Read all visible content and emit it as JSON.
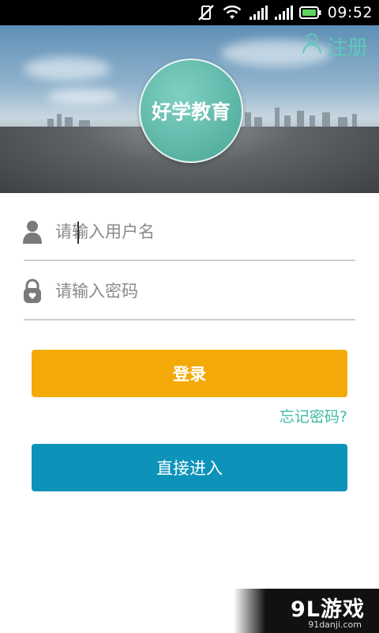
{
  "status_bar": {
    "time": "09:52"
  },
  "header": {
    "register_label": "注册",
    "logo_text": "好学教育"
  },
  "form": {
    "username_placeholder": "请输入用户名",
    "username_value": "",
    "password_placeholder": "请输入密码",
    "password_value": ""
  },
  "actions": {
    "login_label": "登录",
    "forgot_label": "忘记密码?",
    "enter_label": "直接进入"
  },
  "watermark": {
    "brand": "9L游戏",
    "url": "91danji.com"
  },
  "colors": {
    "accent_teal": "#40b9a5",
    "login_orange": "#f3aa09",
    "enter_blue": "#0d93b9"
  }
}
